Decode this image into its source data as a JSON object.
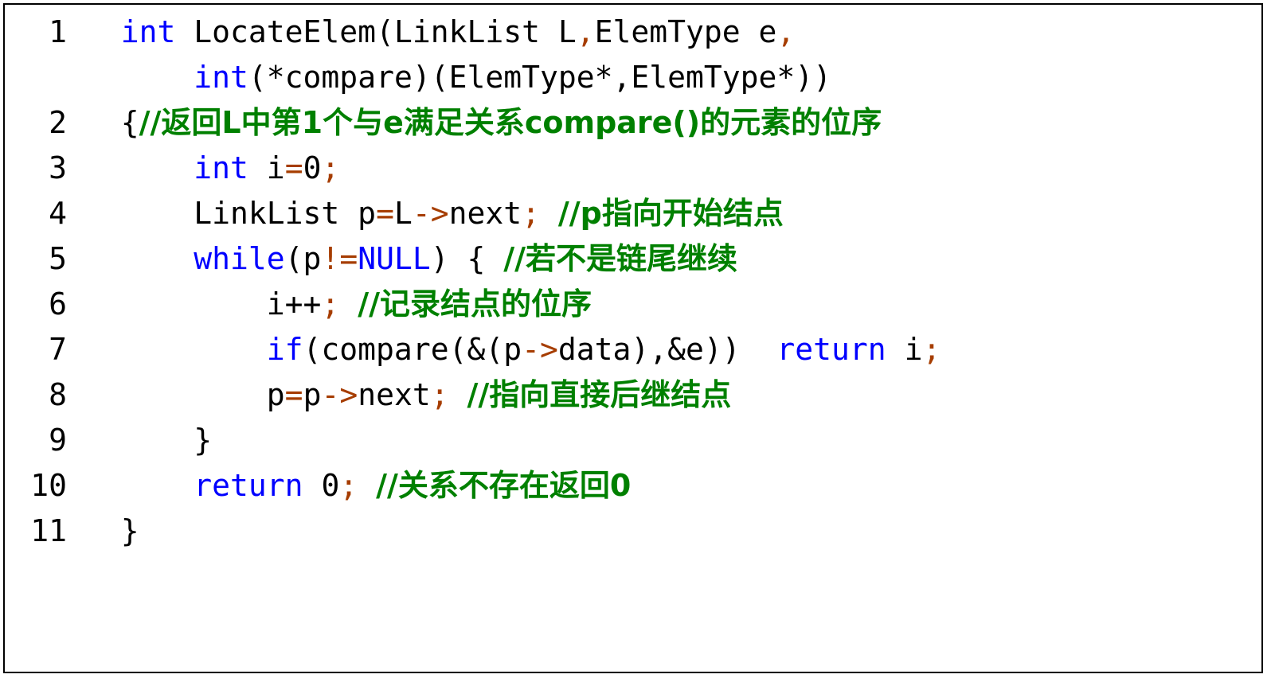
{
  "editor": {
    "language": "C",
    "font_family_hint": "monospace",
    "colors": {
      "background": "#ffffff",
      "border": "#000000",
      "plain_text": "#000000",
      "keyword": "#0000ff",
      "comment": "#008000",
      "operator": "#a63d00",
      "line_number": "#000000"
    },
    "total_lines": 11
  },
  "code": {
    "lines": [
      {
        "number": "1",
        "tokens": [
          {
            "text": "  ",
            "type": "plain"
          },
          {
            "text": "int",
            "type": "kw"
          },
          {
            "text": " LocateElem(LinkList L",
            "type": "plain"
          },
          {
            "text": ",",
            "type": "op"
          },
          {
            "text": "ElemType e",
            "type": "plain"
          },
          {
            "text": ",",
            "type": "op"
          }
        ]
      },
      {
        "number": "",
        "tokens": [
          {
            "text": "      ",
            "type": "plain"
          },
          {
            "text": "int",
            "type": "kw"
          },
          {
            "text": "(*compare)(ElemType*,ElemType*))",
            "type": "plain"
          }
        ]
      },
      {
        "number": "2",
        "tokens": [
          {
            "text": "  ",
            "type": "plain"
          },
          {
            "text": "{",
            "type": "plain"
          },
          {
            "text": "//返回L中第1个与e满足关系compare()的元素的位序",
            "type": "cmt"
          }
        ]
      },
      {
        "number": "3",
        "tokens": [
          {
            "text": "      ",
            "type": "plain"
          },
          {
            "text": "int",
            "type": "kw"
          },
          {
            "text": " i",
            "type": "plain"
          },
          {
            "text": "=",
            "type": "op"
          },
          {
            "text": "0",
            "type": "num"
          },
          {
            "text": ";",
            "type": "op"
          }
        ]
      },
      {
        "number": "4",
        "tokens": [
          {
            "text": "      ",
            "type": "plain"
          },
          {
            "text": "LinkList p",
            "type": "plain"
          },
          {
            "text": "=",
            "type": "op"
          },
          {
            "text": "L",
            "type": "plain"
          },
          {
            "text": "->",
            "type": "op"
          },
          {
            "text": "next",
            "type": "plain"
          },
          {
            "text": ";",
            "type": "op"
          },
          {
            "text": " ",
            "type": "plain"
          },
          {
            "text": "//p指向开始结点",
            "type": "cmt"
          }
        ]
      },
      {
        "number": "5",
        "tokens": [
          {
            "text": "      ",
            "type": "plain"
          },
          {
            "text": "while",
            "type": "kw"
          },
          {
            "text": "(p",
            "type": "plain"
          },
          {
            "text": "!=",
            "type": "op"
          },
          {
            "text": "NULL",
            "type": "kw"
          },
          {
            "text": ") { ",
            "type": "plain"
          },
          {
            "text": "//若不是链尾继续",
            "type": "cmt"
          }
        ]
      },
      {
        "number": "6",
        "tokens": [
          {
            "text": "          ",
            "type": "plain"
          },
          {
            "text": "i++",
            "type": "plain"
          },
          {
            "text": ";",
            "type": "op"
          },
          {
            "text": " ",
            "type": "plain"
          },
          {
            "text": "//记录结点的位序",
            "type": "cmt"
          }
        ]
      },
      {
        "number": "7",
        "tokens": [
          {
            "text": "          ",
            "type": "plain"
          },
          {
            "text": "if",
            "type": "kw"
          },
          {
            "text": "(compare(&(p",
            "type": "plain"
          },
          {
            "text": "->",
            "type": "op"
          },
          {
            "text": "data),&e))  ",
            "type": "plain"
          },
          {
            "text": "return",
            "type": "kw"
          },
          {
            "text": " i",
            "type": "plain"
          },
          {
            "text": ";",
            "type": "op"
          }
        ]
      },
      {
        "number": "8",
        "tokens": [
          {
            "text": "          ",
            "type": "plain"
          },
          {
            "text": "p",
            "type": "plain"
          },
          {
            "text": "=",
            "type": "op"
          },
          {
            "text": "p",
            "type": "plain"
          },
          {
            "text": "->",
            "type": "op"
          },
          {
            "text": "next",
            "type": "plain"
          },
          {
            "text": ";",
            "type": "op"
          },
          {
            "text": " ",
            "type": "plain"
          },
          {
            "text": "//指向直接后继结点",
            "type": "cmt"
          }
        ]
      },
      {
        "number": "9",
        "tokens": [
          {
            "text": "      ",
            "type": "plain"
          },
          {
            "text": "}",
            "type": "plain"
          }
        ]
      },
      {
        "number": "10",
        "tokens": [
          {
            "text": "      ",
            "type": "plain"
          },
          {
            "text": "return",
            "type": "kw"
          },
          {
            "text": " ",
            "type": "plain"
          },
          {
            "text": "0",
            "type": "num"
          },
          {
            "text": ";",
            "type": "op"
          },
          {
            "text": " ",
            "type": "plain"
          },
          {
            "text": "//关系不存在返回0",
            "type": "cmt"
          }
        ]
      },
      {
        "number": "11",
        "tokens": [
          {
            "text": "  ",
            "type": "plain"
          },
          {
            "text": "}",
            "type": "plain"
          }
        ]
      }
    ]
  }
}
